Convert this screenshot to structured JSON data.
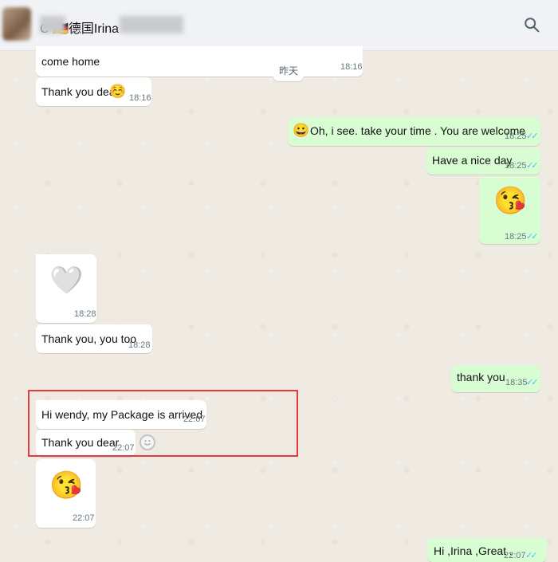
{
  "header": {
    "contact_name": "C     🇩🇪德国Irina"
  },
  "date_chip": "昨天",
  "messages": {
    "m1": {
      "text": "come home",
      "time": "18:16"
    },
    "m2": {
      "text": "Thank you dear",
      "emoji": "☺️",
      "time": "18:16"
    },
    "m3": {
      "emoji": "😀",
      "text": "Oh, i see.  take your time .  You are welcome",
      "time": "18:25"
    },
    "m4": {
      "text": "Have a nice day",
      "time": "18:25"
    },
    "m5": {
      "emoji": "😘",
      "time": "18:25"
    },
    "m6": {
      "emoji": "🤍",
      "time": "18:28"
    },
    "m7": {
      "text": "Thank you, you too",
      "time": "18:28"
    },
    "m8": {
      "text": "thank you",
      "time": "18:35"
    },
    "m9": {
      "text": "Hi wendy, my Package is arrived",
      "time": "22:07"
    },
    "m10": {
      "text": "Thank you dear",
      "time": "22:07"
    },
    "m11": {
      "emoji": "😘",
      "time": "22:07"
    },
    "m12": {
      "text": "Hi ,Irina ,Great .",
      "time": "22:07"
    }
  },
  "colors": {
    "incoming": "#ffffff",
    "outgoing": "#d9fdd3",
    "read_ticks": "#53bdeb",
    "highlight": "#e23c3c"
  },
  "icons": [
    "search-icon",
    "double-check-icon",
    "reaction-icon"
  ]
}
